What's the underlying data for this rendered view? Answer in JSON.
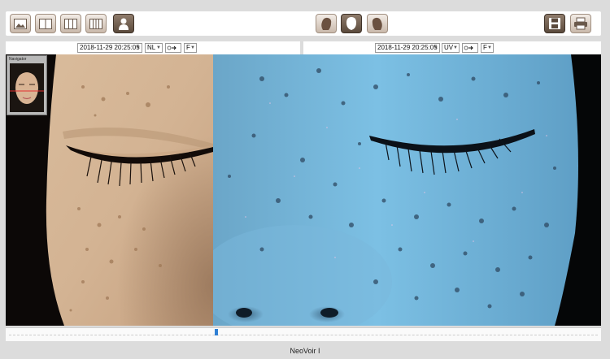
{
  "toolbar": {
    "left_buttons": [
      "image-view-icon",
      "two-pane-icon",
      "three-pane-icon",
      "four-pane-icon",
      "profile-icon"
    ],
    "center_buttons": [
      "face-left-icon",
      "face-front-icon",
      "face-right-icon"
    ],
    "right_buttons": [
      "save-icon",
      "print-icon"
    ]
  },
  "left_panel": {
    "datetime": "2018-11-29 20:25:05",
    "mode": "NL",
    "face": "F"
  },
  "right_panel": {
    "datetime": "2018-11-29 20:25:05",
    "mode": "UV",
    "face": "F"
  },
  "navigator": {
    "title": "Navigator"
  },
  "timeline": {
    "position": 0.35
  },
  "footer": {
    "brand": "NeoVoir I"
  }
}
